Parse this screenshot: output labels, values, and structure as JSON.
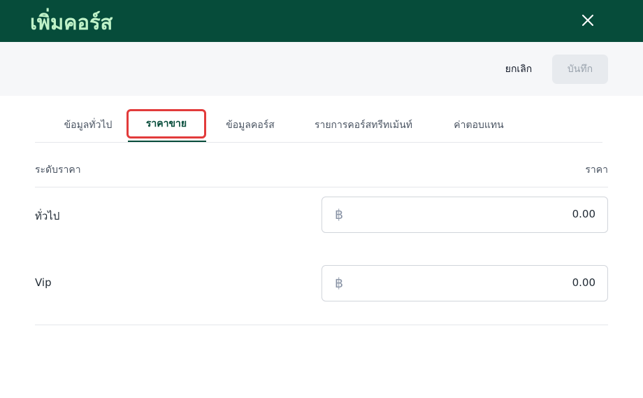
{
  "header": {
    "title": "เพิ่มคอร์ส",
    "close_icon": "close-icon"
  },
  "toolbar": {
    "cancel_label": "ยกเลิก",
    "save_label": "บันทึก"
  },
  "tabs": [
    {
      "label": "ข้อมูลทั่วไป",
      "active": false
    },
    {
      "label": "ราคาขาย",
      "active": true
    },
    {
      "label": "ข้อมูลคอร์ส",
      "active": false
    },
    {
      "label": "รายการคอร์สทรีทเม้นท์",
      "active": false
    },
    {
      "label": "ค่าตอบแทน",
      "active": false
    }
  ],
  "price_table": {
    "col_level": "ระดับราคา",
    "col_price": "ราคา",
    "rows": [
      {
        "level": "ทั่วไป",
        "currency_symbol": "฿",
        "value": "0.00"
      },
      {
        "level": "Vip",
        "currency_symbol": "฿",
        "value": "0.00"
      }
    ]
  },
  "colors": {
    "header_bg": "#064c3a",
    "title_color": "#bff2c8",
    "active_tab": "#064c3a",
    "highlight_border": "#e23b3b"
  }
}
